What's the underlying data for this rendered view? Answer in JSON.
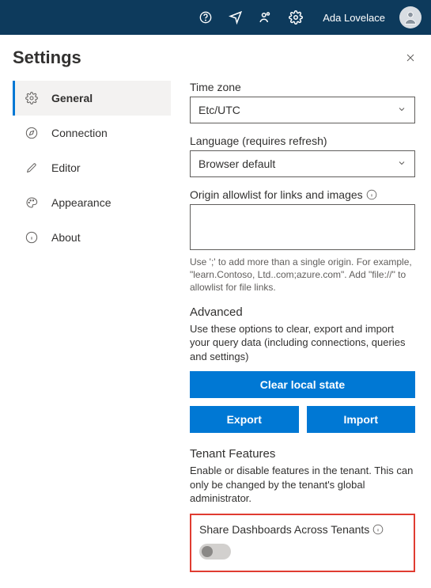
{
  "header": {
    "username": "Ada Lovelace"
  },
  "panel": {
    "title": "Settings"
  },
  "sidebar": {
    "items": [
      {
        "label": "General"
      },
      {
        "label": "Connection"
      },
      {
        "label": "Editor"
      },
      {
        "label": "Appearance"
      },
      {
        "label": "About"
      }
    ]
  },
  "fields": {
    "timezone_label": "Time zone",
    "timezone_value": "Etc/UTC",
    "language_label": "Language (requires refresh)",
    "language_value": "Browser default",
    "origin_label": "Origin allowlist for links and images",
    "origin_value": "",
    "origin_hint": "Use ';' to add more than a single origin. For example, \"learn.Contoso, Ltd..com;azure.com\". Add \"file://\" to allowlist for file links."
  },
  "advanced": {
    "heading": "Advanced",
    "desc": "Use these options to clear, export and import your query data (including connections, queries and settings)",
    "clear_label": "Clear local state",
    "export_label": "Export",
    "import_label": "Import"
  },
  "tenant": {
    "heading": "Tenant Features",
    "desc": "Enable or disable features in the tenant. This can only be changed by the tenant's global administrator.",
    "toggle_label": "Share Dashboards Across Tenants",
    "toggle_on": false
  }
}
